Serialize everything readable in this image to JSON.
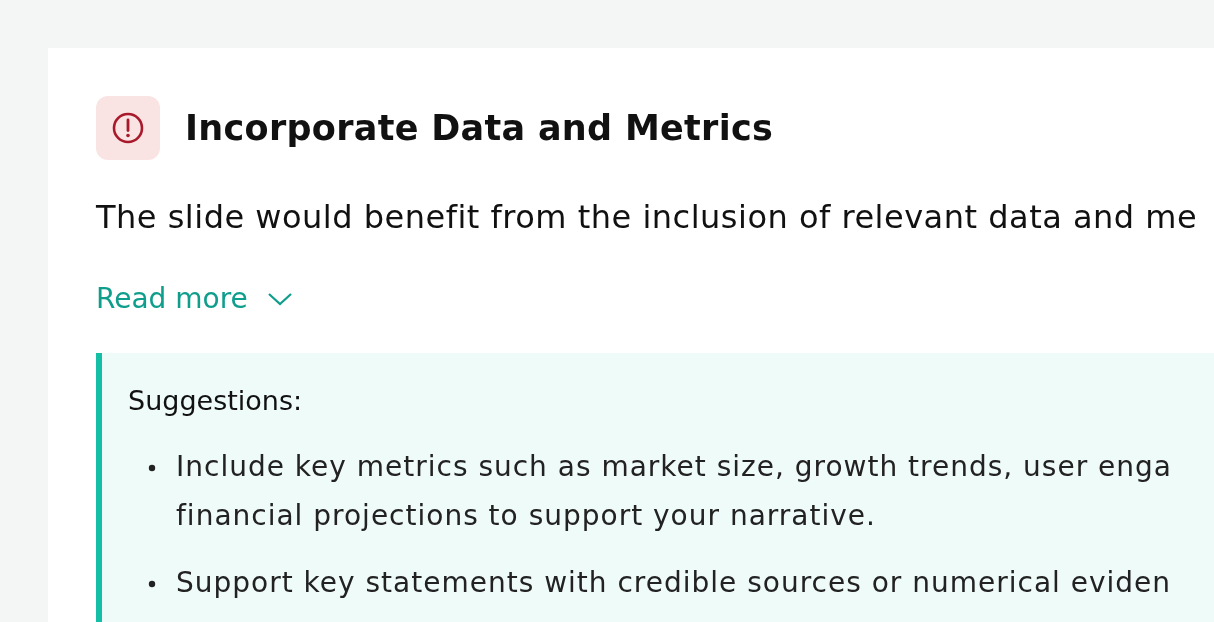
{
  "issue": {
    "title": "Incorporate Data and Metrics",
    "description": "The slide would benefit from the inclusion of relevant data and me",
    "read_more": {
      "label": "Read more",
      "expanded": false
    }
  },
  "suggestions": {
    "heading": "Suggestions:",
    "items": [
      {
        "lines": [
          "Include key metrics such as market size, growth trends, user enga",
          "financial projections to support your narrative."
        ]
      },
      {
        "lines": [
          "Support key statements with credible sources or numerical eviden"
        ]
      }
    ]
  }
}
